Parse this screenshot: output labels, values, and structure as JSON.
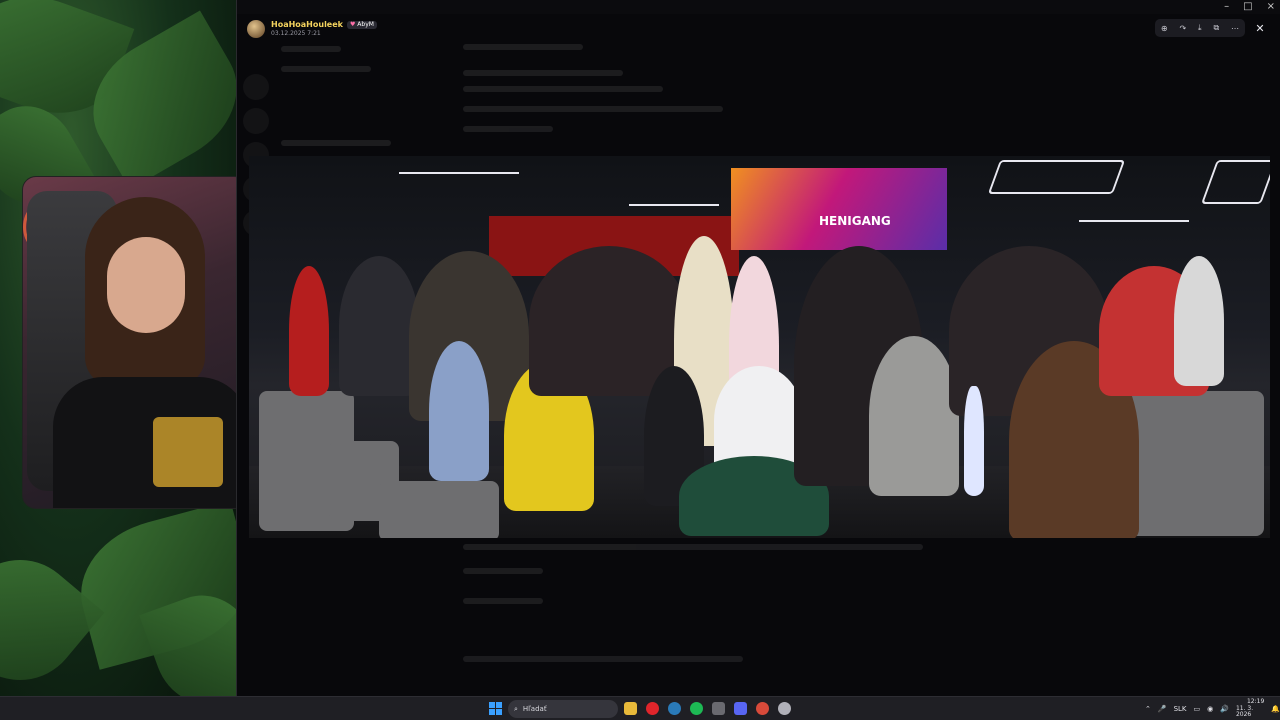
{
  "window": {
    "controls": {
      "minimize": "–",
      "maximize": "□",
      "close": "×"
    }
  },
  "viewer": {
    "username": "HoaHoaHouleek",
    "badge_label": "AbyM",
    "badge_heart": "♥",
    "timestamp": "03.12.2025 7:21",
    "tools": {
      "zoom": "⊕",
      "forward": "↷",
      "download": "⤓",
      "open_external": "⧉",
      "more": "⋯"
    },
    "close": "✕"
  },
  "photo": {
    "screen_text": "HENIGANG"
  },
  "taskbar": {
    "search_placeholder": "Hľadať",
    "search_icon": "⌕",
    "language": "SLK",
    "time": "12:19",
    "date": "11. 3. 2026",
    "tray_chevron": "⌃",
    "mic_icon": "🎤",
    "wifi_icon": "◉",
    "volume_icon": "🔊",
    "bell_icon": "🔔",
    "display_icon": "▭",
    "apps": [
      {
        "name": "file-explorer",
        "color": "#e8b93a"
      },
      {
        "name": "opera",
        "color": "#e0252b"
      },
      {
        "name": "steam",
        "color": "#2a7ab8"
      },
      {
        "name": "spotify",
        "color": "#1db954"
      },
      {
        "name": "xbox",
        "color": "#6a6a70"
      },
      {
        "name": "discord",
        "color": "#5865f2"
      },
      {
        "name": "chrome",
        "color": "#d84a3a"
      },
      {
        "name": "obs",
        "color": "#b0b0b8"
      }
    ]
  }
}
